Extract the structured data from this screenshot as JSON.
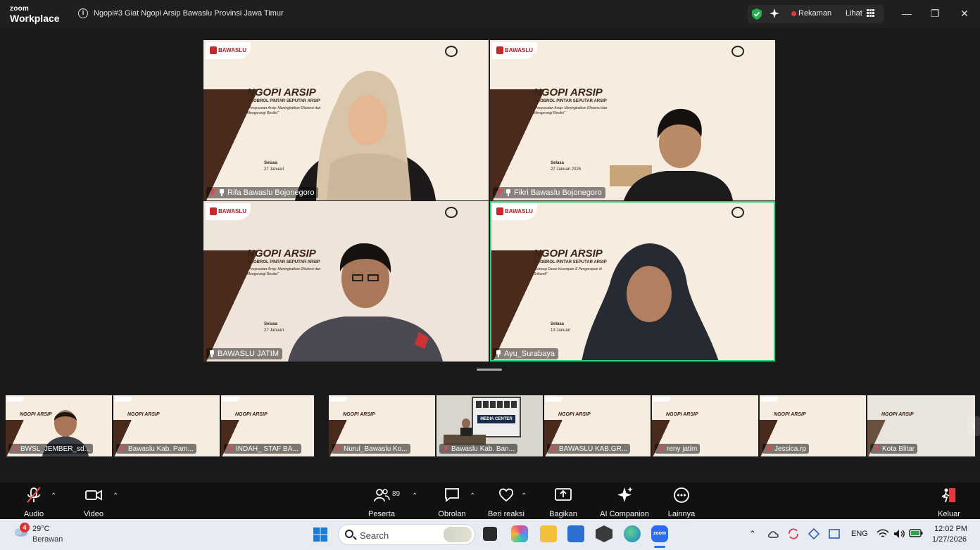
{
  "window": {
    "brand_small": "zoom",
    "brand_large": "Workplace",
    "meeting_title": "Ngopi#3 Giat Ngopi Arsip Bawaslu Provinsi Jawa Timur",
    "recording_label": "Rekaman",
    "view_label": "Lihat",
    "minimize": "—",
    "restore": "❐",
    "close": "✕"
  },
  "stage": {
    "slide_title": "NGOPI ARSIP",
    "slide_sub": "NGOBROL PINTAR SEPUTAR ARSIP",
    "slide_logo": "BAWASLU",
    "tiles": [
      {
        "name": "Rifa Bawaslu Bojonegoro",
        "muted": true,
        "topic": "\"Penyusutan Arsip: Meningkatkan Efisiensi dan Mengurangi Resiko\"",
        "day": "Selasa",
        "date": "27 Januari"
      },
      {
        "name": "Fikri Bawaslu Bojonegoro",
        "muted": true,
        "topic": "\"Penyusutan Arsip: Meningkatkan Efisiensi dan Mengurangi Resiko\"",
        "day": "Selasa",
        "date": "27 Januari 2026"
      },
      {
        "name": "BAWASLU JATIM",
        "muted": false,
        "topic": "\"Penyusutan Arsip: Meningkatkan Efisiensi dan Mengurangi Resiko\"",
        "day": "Selasa",
        "date": "27 Januari"
      },
      {
        "name": "Ayu_Surabaya",
        "muted": false,
        "topic": "\"Konsep Dasar Kearsipan & Pengarsipan di Srikandi\"",
        "day": "Selasa",
        "date": "13 Januari"
      }
    ]
  },
  "gallery": [
    {
      "name": "BWSL_JEMBER_sd..."
    },
    {
      "name": "Bawaslu Kab. Pam..."
    },
    {
      "name": "INDAH_ STAF BA..."
    },
    {
      "name": "Nurul_Bawaslu Ko..."
    },
    {
      "name": "Bawaslu Kab. Ban...",
      "banner": "MEDIA CENTER"
    },
    {
      "name": "BAWASLU KAB.GR..."
    },
    {
      "name": "reny jatim"
    },
    {
      "name": "Jessica.rp"
    },
    {
      "name": "Kota Blitar"
    }
  ],
  "controls": {
    "audio": "Audio",
    "video": "Video",
    "participants": "Peserta",
    "participants_count": "89",
    "chat": "Obrolan",
    "reactions": "Beri reaksi",
    "share": "Bagikan",
    "ai": "AI Companion",
    "more": "Lainnya",
    "leave": "Keluar"
  },
  "taskbar": {
    "weather_badge": "4",
    "temperature": "29°C",
    "condition": "Berawan",
    "search_placeholder": "Search",
    "language": "ENG",
    "time": "12:02 PM",
    "date": "1/27/2026",
    "zoom_app_label": "zoom"
  },
  "colors": {
    "accent_active": "#2fd37a",
    "muted_red": "#e34850",
    "record_red": "#e0393e",
    "slide_bg": "#f7ece0",
    "slide_dark": "#4a2a1c"
  }
}
